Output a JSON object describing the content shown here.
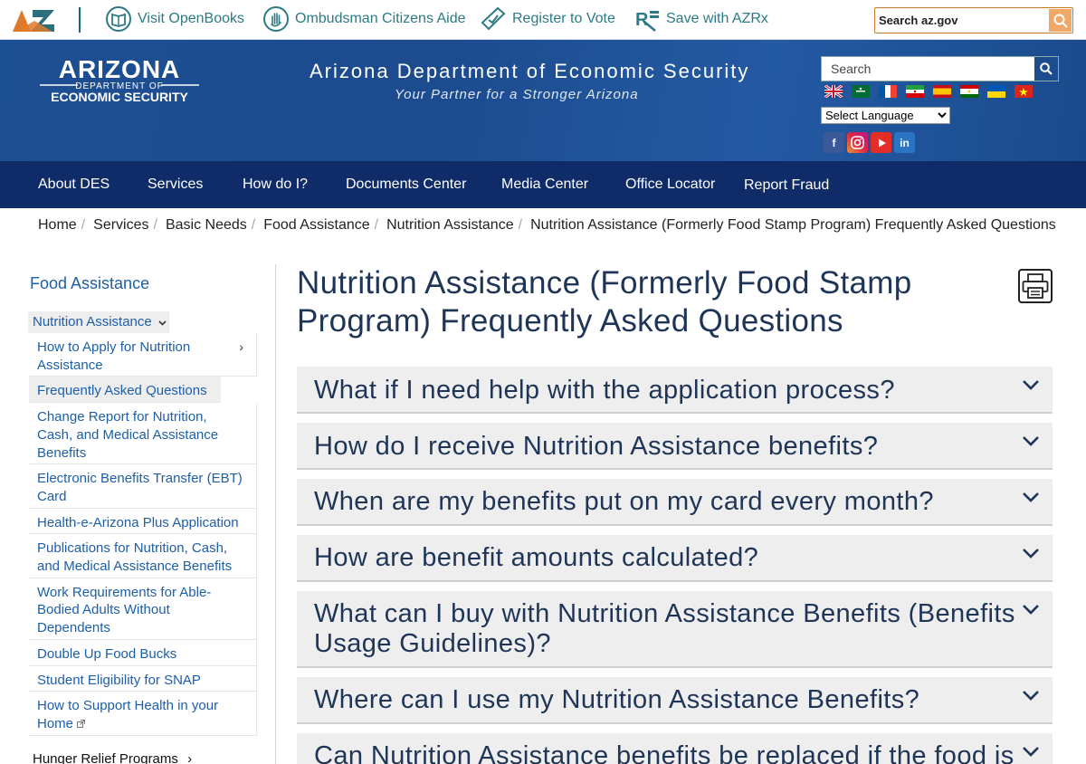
{
  "topbar": {
    "links": [
      {
        "label": "Visit OpenBooks",
        "icon": "openbooks-icon"
      },
      {
        "label": "Ombudsman Citizens Aide",
        "icon": "hand-icon"
      },
      {
        "label": "Register to Vote",
        "icon": "ballot-icon"
      },
      {
        "label": "Save with AZRx",
        "icon": "prescription-icon"
      }
    ],
    "search_placeholder": "Search az.gov"
  },
  "header": {
    "logo_top": "ARIZONA",
    "logo_mid": "DEPARTMENT OF",
    "logo_bottom": "ECONOMIC SECURITY",
    "title": "Arizona Department of Economic Security",
    "tagline": "Your Partner for a Stronger Arizona",
    "search_placeholder": "Search",
    "language_select": "Select Language",
    "social": [
      "facebook-icon",
      "instagram-icon",
      "youtube-icon",
      "linkedin-icon"
    ]
  },
  "nav": {
    "items": [
      "About DES",
      "Services",
      "How do I?",
      "Documents Center",
      "Media Center",
      "Office Locator",
      "Report Fraud"
    ]
  },
  "breadcrumb": [
    "Home",
    "Services",
    "Basic Needs",
    "Food Assistance",
    "Nutrition Assistance",
    "Nutrition Assistance (Formerly Food Stamp Program) Frequently Asked Questions"
  ],
  "sidebar": {
    "heading": "Food Assistance",
    "parent": "Nutrition Assistance",
    "items": [
      "How to Apply for Nutrition Assistance",
      "Frequently Asked Questions",
      "Change Report for Nutrition, Cash, and Medical Assistance Benefits",
      "Electronic Benefits Transfer (EBT) Card",
      "Health-e-Arizona Plus Application",
      "Publications for Nutrition, Cash, and Medical Assistance Benefits",
      "Work Requirements for Able-Bodied Adults Without Dependents",
      "Double Up Food Bucks",
      "Student Eligibility for SNAP",
      "How to Support Health in your Home"
    ],
    "next_section": "Hunger Relief Programs"
  },
  "content": {
    "title": "Nutrition Assistance (Formerly Food Stamp Program) Frequently Asked Questions",
    "faqs": [
      "What if I need help with the application process?",
      "How do I receive Nutrition Assistance benefits?",
      "When are my benefits put on my card every month?",
      "How are benefit amounts calculated?",
      "What can I buy with Nutrition Assistance Benefits (Benefits Usage Guidelines)?",
      "Where can I use my Nutrition Assistance Benefits?",
      "Can Nutrition Assistance benefits be replaced if the food is"
    ]
  },
  "colors": {
    "nav_bg": "#0f2b68",
    "header_bg": "#1c4b8e",
    "link": "#1d5fa8",
    "title": "#1f3557",
    "topbar_link": "#2c7a86"
  }
}
